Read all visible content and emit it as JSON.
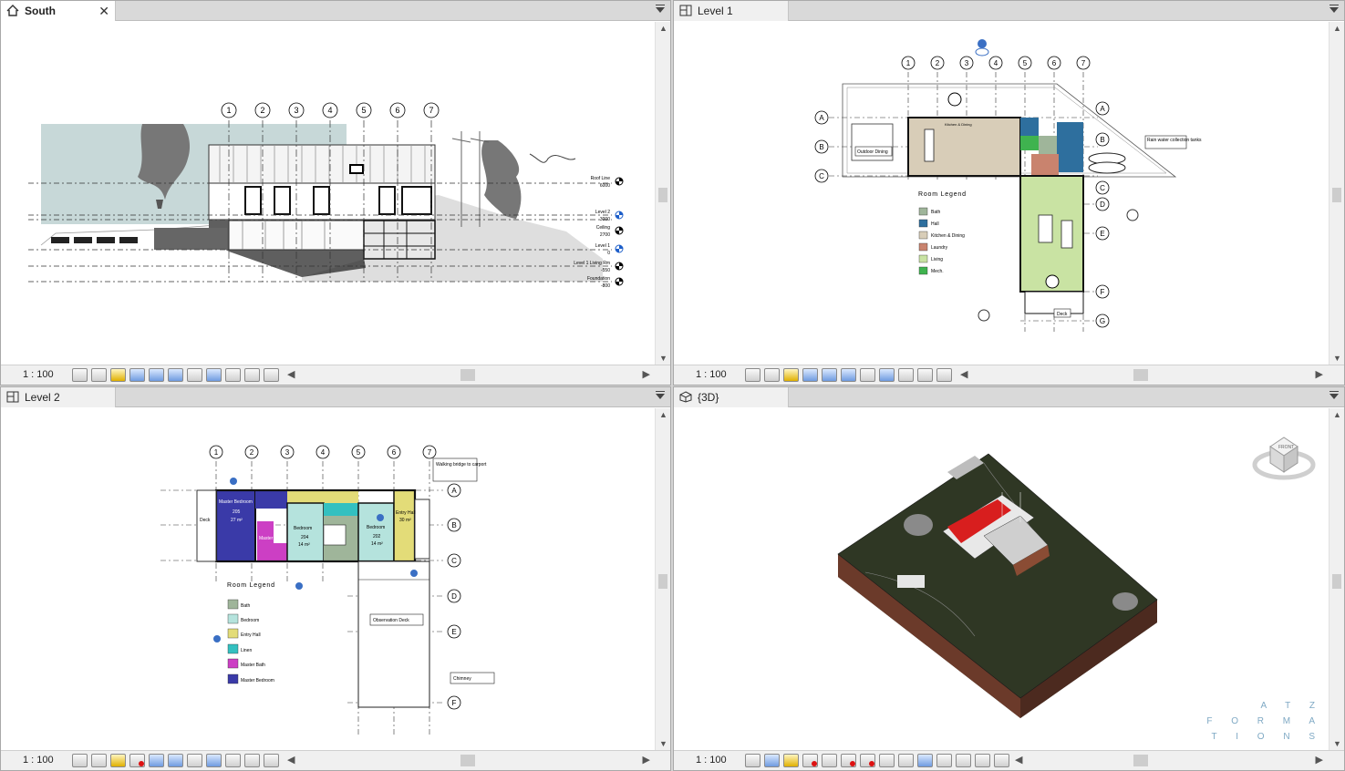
{
  "views": {
    "south": {
      "tab": "South",
      "scale": "1 : 100"
    },
    "level1": {
      "tab": "Level 1",
      "scale": "1 : 100"
    },
    "level2": {
      "tab": "Level 2",
      "scale": "1 : 100"
    },
    "threeD": {
      "tab": "{3D}",
      "scale": "1 : 100"
    }
  },
  "grid_labels": [
    "1",
    "2",
    "3",
    "4",
    "5",
    "6",
    "7"
  ],
  "row_labels_l1": [
    "A",
    "B",
    "C",
    "D",
    "E",
    "F",
    "G"
  ],
  "row_labels_l2": [
    "A",
    "B",
    "C",
    "D",
    "E",
    "F"
  ],
  "south": {
    "levels": [
      {
        "name": "Roof Line",
        "value": "6000"
      },
      {
        "name": "Level 2",
        "value": "3000"
      },
      {
        "name": "Ceiling",
        "value": "2700"
      },
      {
        "name": "Level 1",
        "value": "0"
      },
      {
        "name": "Level 1 Living Rm",
        "value": "-550"
      },
      {
        "name": "Foundation",
        "value": "-800"
      }
    ]
  },
  "level1": {
    "legend_title": "Room Legend",
    "legend": [
      {
        "label": "Bath",
        "color": "#9fb59a"
      },
      {
        "label": "Hall",
        "color": "#2e6f9e"
      },
      {
        "label": "Kitchen & Dining",
        "color": "#d8cdb8"
      },
      {
        "label": "Laundry",
        "color": "#c9836e"
      },
      {
        "label": "Living",
        "color": "#c9e3a3"
      },
      {
        "label": "Mech.",
        "color": "#3fb34f"
      }
    ],
    "tags": {
      "outdoor_dining": "Outdoor Dining",
      "kitchen": "Kitchen & Dining",
      "rain_water": "Rain water collection tanks",
      "deck": "Deck"
    }
  },
  "level2": {
    "legend_title": "Room Legend",
    "legend": [
      {
        "label": "Bath",
        "color": "#9fb59a"
      },
      {
        "label": "Bedroom",
        "color": "#b5e3dd"
      },
      {
        "label": "Entry Hall",
        "color": "#e3dc78"
      },
      {
        "label": "Linen",
        "color": "#33c0c0"
      },
      {
        "label": "Master Bath",
        "color": "#cc3fc4"
      },
      {
        "label": "Master Bedroom",
        "color": "#3a3aa8"
      }
    ],
    "tags": {
      "walking_bridge": "Walking bridge to carport",
      "observation_deck": "Observation Deck",
      "chimney": "Chimney",
      "deck": "Deck",
      "master_bedroom": "Master Bedroom",
      "master_bedroom_num": "205",
      "master_bedroom_area": "27 m²",
      "master_bath": "Master Bath",
      "bedroom1": "Bedroom",
      "bedroom1_num": "204",
      "bedroom1_area": "14 m²",
      "bedroom2": "Bedroom",
      "bedroom2_num": "202",
      "bedroom2_area": "14 m²",
      "entry_hall": "Entry Hall",
      "entry_hall_area": "30 m²"
    }
  },
  "threeD": {
    "viewcube_label": "FRONT",
    "watermark": [
      "A T Z",
      "F O R M A",
      "T I O N S"
    ]
  }
}
